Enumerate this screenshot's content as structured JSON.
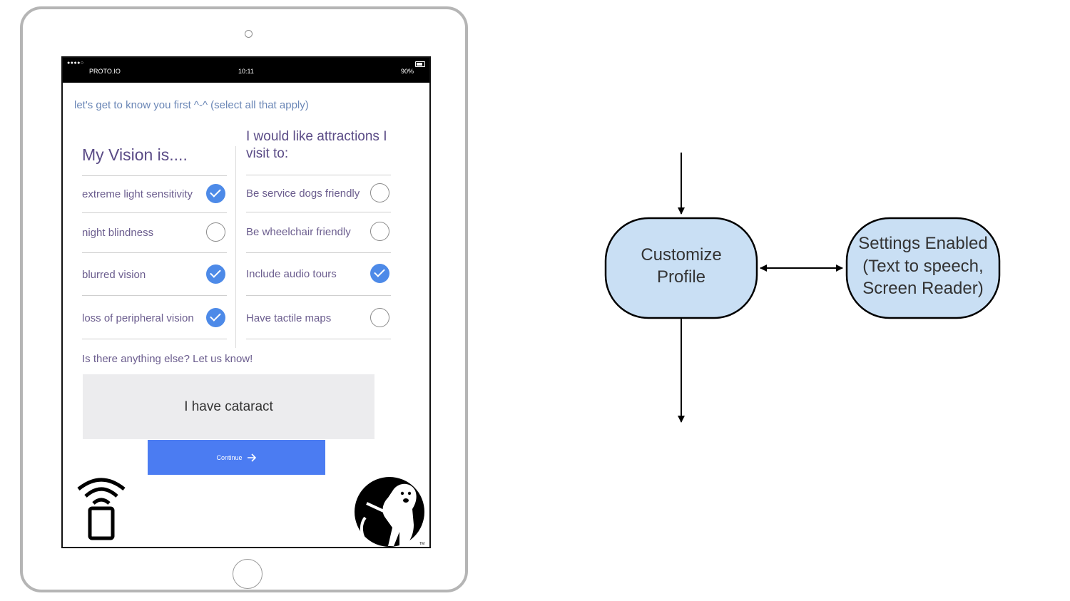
{
  "statusbar": {
    "signal": "●●●●○",
    "carrier": "PROTO.IO",
    "time": "10:11",
    "battery": "90%"
  },
  "intro": "let's get to know you first ^-^  (select all that apply)",
  "vision": {
    "title": "My Vision is....",
    "items": [
      {
        "label": "extreme light sensitivity",
        "checked": true
      },
      {
        "label": "night blindness",
        "checked": false
      },
      {
        "label": "blurred vision",
        "checked": true
      },
      {
        "label": "loss of peripheral vision",
        "checked": true
      }
    ]
  },
  "attractions": {
    "title": "I would like attractions I visit to:",
    "items": [
      {
        "label": "Be service dogs friendly",
        "checked": false
      },
      {
        "label": "Be wheelchair friendly",
        "checked": false
      },
      {
        "label": "Include audio tours",
        "checked": true
      },
      {
        "label": "Have tactile maps",
        "checked": false
      }
    ]
  },
  "other": {
    "prompt": "Is there anything else? Let us know!",
    "value": "I have cataract"
  },
  "continue_label": "Continue",
  "logo_mark": "TM",
  "flowchart": {
    "node1": [
      "Customize",
      "Profile"
    ],
    "node2": [
      "Settings Enabled",
      "(Text to speech,",
      "Screen Reader)"
    ],
    "node_fill": "#c9dff4"
  },
  "colors": {
    "accent": "#4b7cf2",
    "check": "#4d8ae8",
    "heading": "#5a4b86"
  }
}
